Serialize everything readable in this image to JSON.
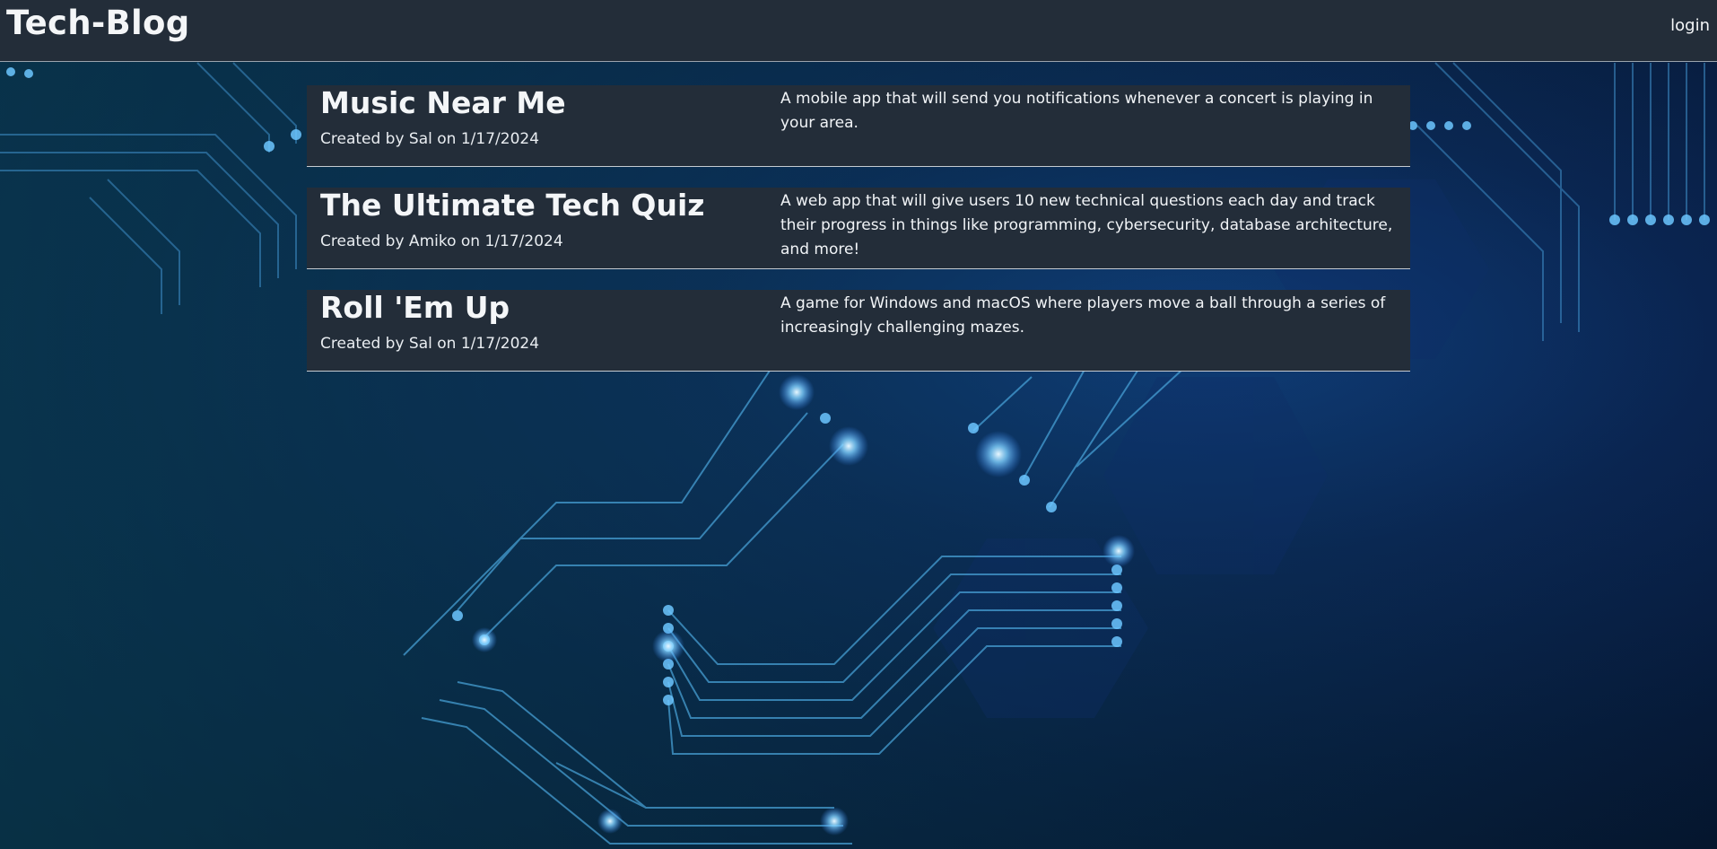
{
  "header": {
    "site_title": "Tech-Blog",
    "login_label": "login"
  },
  "posts": [
    {
      "title": "Music Near Me",
      "meta": "Created by Sal on 1/17/2024",
      "description": "A mobile app that will send you notifications whenever a concert is playing in your area."
    },
    {
      "title": "The Ultimate Tech Quiz",
      "meta": "Created by Amiko on 1/17/2024",
      "description": "A web app that will give users 10 new technical questions each day and track their progress in things like programming, cybersecurity, database architecture, and more!"
    },
    {
      "title": "Roll 'Em Up",
      "meta": "Created by Sal on 1/17/2024",
      "description": "A game for Windows and macOS where players move a ball through a series of increasingly challenging mazes."
    }
  ],
  "colors": {
    "header_bg": "#232d39",
    "card_bg": "#232d39",
    "circuit_glow": "#5fb8ff",
    "background_deep": "#061a38"
  }
}
